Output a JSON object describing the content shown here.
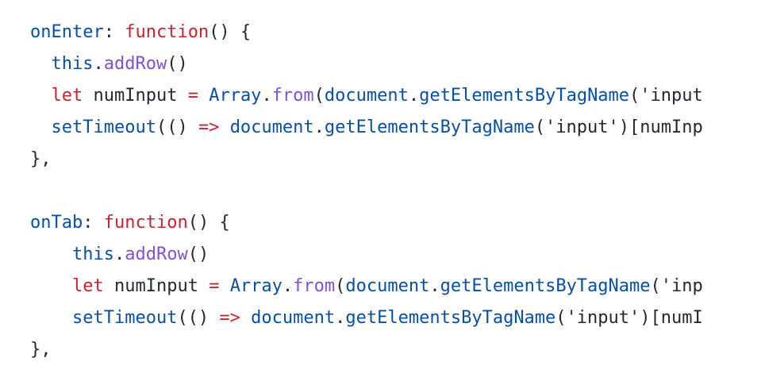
{
  "colors": {
    "keyword": "#cf222e",
    "property": "#0550ae",
    "method": "#8250df",
    "plain": "#24292f",
    "background": "#ffffff"
  },
  "code": {
    "lines": [
      {
        "tokens": [
          {
            "text": "onEnter",
            "kind": "property"
          },
          {
            "text": ": ",
            "kind": "plain"
          },
          {
            "text": "function",
            "kind": "keyword"
          },
          {
            "text": "() {",
            "kind": "plain"
          }
        ]
      },
      {
        "tokens": [
          {
            "text": "  ",
            "kind": "plain"
          },
          {
            "text": "this",
            "kind": "property"
          },
          {
            "text": ".",
            "kind": "plain"
          },
          {
            "text": "addRow",
            "kind": "method"
          },
          {
            "text": "()",
            "kind": "plain"
          }
        ]
      },
      {
        "tokens": [
          {
            "text": "  ",
            "kind": "plain"
          },
          {
            "text": "let",
            "kind": "keyword"
          },
          {
            "text": " numInput ",
            "kind": "plain"
          },
          {
            "text": "=",
            "kind": "keyword"
          },
          {
            "text": " ",
            "kind": "plain"
          },
          {
            "text": "Array",
            "kind": "property"
          },
          {
            "text": ".",
            "kind": "plain"
          },
          {
            "text": "from",
            "kind": "method"
          },
          {
            "text": "(",
            "kind": "plain"
          },
          {
            "text": "document",
            "kind": "property"
          },
          {
            "text": ".",
            "kind": "plain"
          },
          {
            "text": "getElementsByTagName",
            "kind": "property"
          },
          {
            "text": "('input",
            "kind": "plain"
          }
        ]
      },
      {
        "tokens": [
          {
            "text": "  ",
            "kind": "plain"
          },
          {
            "text": "setTimeout",
            "kind": "property"
          },
          {
            "text": "(() ",
            "kind": "plain"
          },
          {
            "text": "=>",
            "kind": "keyword"
          },
          {
            "text": " ",
            "kind": "plain"
          },
          {
            "text": "document",
            "kind": "property"
          },
          {
            "text": ".",
            "kind": "plain"
          },
          {
            "text": "getElementsByTagName",
            "kind": "property"
          },
          {
            "text": "('input')[numInp",
            "kind": "plain"
          }
        ]
      },
      {
        "tokens": [
          {
            "text": "},",
            "kind": "plain"
          }
        ]
      },
      {
        "tokens": []
      },
      {
        "tokens": [
          {
            "text": "onTab",
            "kind": "property"
          },
          {
            "text": ": ",
            "kind": "plain"
          },
          {
            "text": "function",
            "kind": "keyword"
          },
          {
            "text": "() {",
            "kind": "plain"
          }
        ]
      },
      {
        "tokens": [
          {
            "text": "    ",
            "kind": "plain"
          },
          {
            "text": "this",
            "kind": "property"
          },
          {
            "text": ".",
            "kind": "plain"
          },
          {
            "text": "addRow",
            "kind": "method"
          },
          {
            "text": "()",
            "kind": "plain"
          }
        ]
      },
      {
        "tokens": [
          {
            "text": "    ",
            "kind": "plain"
          },
          {
            "text": "let",
            "kind": "keyword"
          },
          {
            "text": " numInput ",
            "kind": "plain"
          },
          {
            "text": "=",
            "kind": "keyword"
          },
          {
            "text": " ",
            "kind": "plain"
          },
          {
            "text": "Array",
            "kind": "property"
          },
          {
            "text": ".",
            "kind": "plain"
          },
          {
            "text": "from",
            "kind": "method"
          },
          {
            "text": "(",
            "kind": "plain"
          },
          {
            "text": "document",
            "kind": "property"
          },
          {
            "text": ".",
            "kind": "plain"
          },
          {
            "text": "getElementsByTagName",
            "kind": "property"
          },
          {
            "text": "('inp",
            "kind": "plain"
          }
        ]
      },
      {
        "tokens": [
          {
            "text": "    ",
            "kind": "plain"
          },
          {
            "text": "setTimeout",
            "kind": "property"
          },
          {
            "text": "(() ",
            "kind": "plain"
          },
          {
            "text": "=>",
            "kind": "keyword"
          },
          {
            "text": " ",
            "kind": "plain"
          },
          {
            "text": "document",
            "kind": "property"
          },
          {
            "text": ".",
            "kind": "plain"
          },
          {
            "text": "getElementsByTagName",
            "kind": "property"
          },
          {
            "text": "('input')[numI",
            "kind": "plain"
          }
        ]
      },
      {
        "tokens": [
          {
            "text": "},",
            "kind": "plain"
          }
        ]
      }
    ]
  }
}
